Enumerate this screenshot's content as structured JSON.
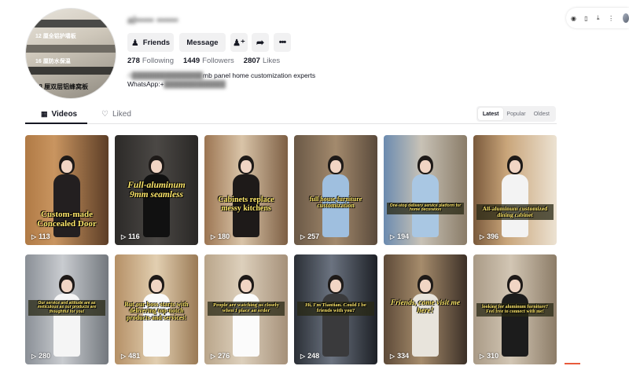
{
  "profile": {
    "username": "al••••• ••••••",
    "avatar_texts": [
      "12 厘全铝护墙板",
      "16 厘防水保温",
      "18 厘双层铝蜂窝板"
    ],
    "buttons": {
      "friends": "Friends",
      "message": "Message"
    },
    "stats": {
      "following_count": "278",
      "following_label": "Following",
      "followers_count": "1449",
      "followers_label": "Followers",
      "likes_count": "2807",
      "likes_label": "Likes"
    },
    "bio_line1_visible": "mb panel home customization experts",
    "bio_line2_label": "WhatsApp:+"
  },
  "tabs": {
    "videos": "Videos",
    "liked": "Liked"
  },
  "sort": {
    "latest": "Latest",
    "popular": "Popular",
    "oldest": "Oldest"
  },
  "videos": [
    {
      "caption": "Custom-made Concealed Door",
      "plays": "113"
    },
    {
      "caption": "Full-aluminum 9mm seamless",
      "plays": "116"
    },
    {
      "caption": "Cabinets replace messy kitchens",
      "plays": "180"
    },
    {
      "caption": "full house furniture customization",
      "plays": "257"
    },
    {
      "caption": "One-stop delivery service platform for home decoration",
      "plays": "194"
    },
    {
      "caption": "All-aluminum customized dining cabinet",
      "plays": "396"
    },
    {
      "caption": "Our service and attitude are as meticulous as our products are thoughtful for you!",
      "plays": "280"
    },
    {
      "caption": "But our boss starts with delivering top-notch products and services!",
      "plays": "481"
    },
    {
      "caption": "People are watching us closely when I place an order",
      "plays": "276"
    },
    {
      "caption": "Hi, I'm Tiantian. Could I be friends with you?",
      "plays": "248"
    },
    {
      "caption": "Friends, come visit me here!",
      "plays": "334"
    },
    {
      "caption": "looking for aluminum furniture? Feel free to connect with me!",
      "plays": "310"
    }
  ],
  "colors": {
    "accent_dark": "#161823",
    "muted_text": "#6b6e77",
    "caption_yellow": "#ffe86b",
    "button_bg": "#f1f1f2"
  }
}
